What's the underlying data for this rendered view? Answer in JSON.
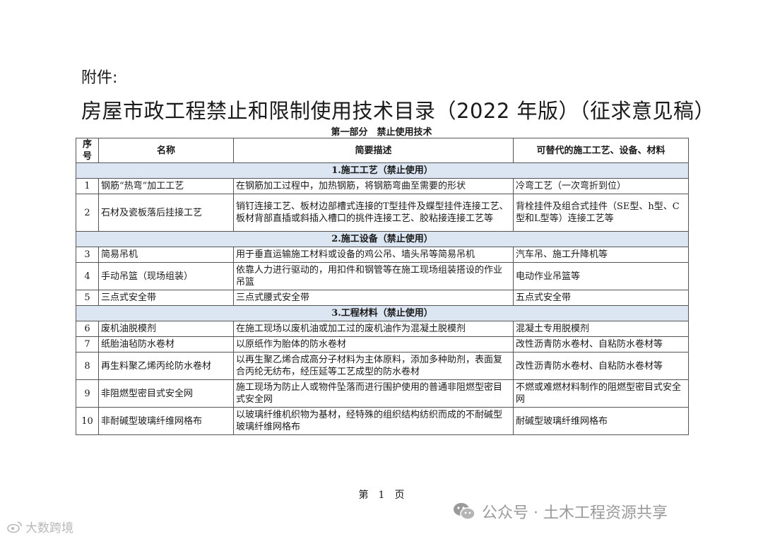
{
  "attachment_label": "附件:",
  "title": "房屋市政工程禁止和限制使用技术目录（2022 年版）（征求意见稿）",
  "part_title": "第一部分　禁止使用技术",
  "headers": [
    "序号",
    "名称",
    "简要描述",
    "可替代的施工工艺、设备、材料"
  ],
  "sections": [
    {
      "heading": "1.施工工艺（禁止使用）",
      "rows": [
        {
          "no": "1",
          "name": "钢筋“热弯”加工工艺",
          "desc": "在钢筋加工过程中，加热钢筋，将钢筋弯曲至需要的形状",
          "alt": "冷弯工艺（一次弯折到位）"
        },
        {
          "no": "2",
          "name": "石材及瓷板落后挂接工艺",
          "desc": "销钉连接工艺、板材边部槽式连接的T型挂件及蝶型挂件连接工艺、板材背部直插或斜插入槽口的挑件连接工艺、胶粘接连接工艺等",
          "alt": "背栓挂件及组合式挂件（SE型、h型、C型和L型等）连接工艺等"
        }
      ]
    },
    {
      "heading": "2.施工设备（禁止使用）",
      "rows": [
        {
          "no": "3",
          "name": "简易吊机",
          "desc": "用于垂直运输施工材料或设备的鸡公吊、墙头吊等简易吊机",
          "alt": "汽车吊、施工升降机等"
        },
        {
          "no": "4",
          "name": "手动吊篮（现场组装）",
          "desc": "依靠人力进行驱动的，用扣件和钢管等在施工现场组装搭设的作业吊篮",
          "alt": "电动作业吊篮等"
        },
        {
          "no": "5",
          "name": "三点式安全带",
          "desc": "三点式腰式安全带",
          "alt": "五点式安全带"
        }
      ]
    },
    {
      "heading": "3.工程材料（禁止使用）",
      "rows": [
        {
          "no": "6",
          "name": "废机油脱模剂",
          "desc": "在施工现场以废机油或加工过的废机油作为混凝土脱模剂",
          "alt": "混凝土专用脱模剂"
        },
        {
          "no": "7",
          "name": "纸胎油毡防水卷材",
          "desc": "以原纸作为胎体的防水卷材",
          "alt": "改性沥青防水卷材、自粘防水卷材等"
        },
        {
          "no": "8",
          "name": "再生料聚乙烯丙纶防水卷材",
          "desc": "以再生聚乙烯合成高分子材料为主体原料，添加多种助剂，表面复合丙纶无纺布，经压延等工艺成型的防水卷材",
          "alt": "改性沥青防水卷材、自粘防水卷材等"
        },
        {
          "no": "9",
          "name": "非阻燃型密目式安全网",
          "desc": "施工现场为防止人或物件坠落而进行围护使用的普通非阻燃型密目式安全网",
          "alt": "不燃或难燃材料制作的阻燃型密目式安全网"
        },
        {
          "no": "10",
          "name": "非耐碱型玻璃纤维网格布",
          "desc": "以玻璃纤维机织物为基材，经特殊的组织结构纺织而成的不耐碱型玻璃纤维网格布",
          "alt": "耐碱型玻璃纤维网格布"
        }
      ]
    }
  ],
  "page_number": "第　1　页",
  "watermark_left": "大数跨境",
  "watermark_right": "公众号 · 土木工程资源共享",
  "colors": {
    "section_bg": "#dce6f2",
    "border": "#555555"
  },
  "icons": [
    "weibo-icon",
    "wechat-icon"
  ]
}
